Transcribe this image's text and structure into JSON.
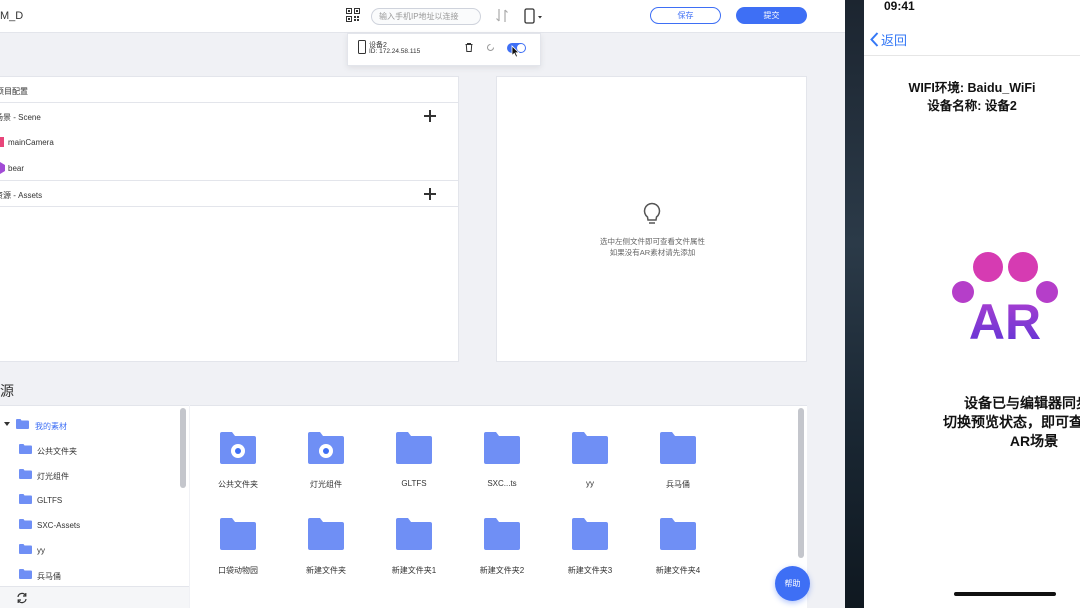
{
  "editor": {
    "title_fragment": "M_D",
    "ip_placeholder": "输入手机IP地址以连接",
    "save_label": "保存",
    "submit_label": "提交",
    "device_popup": {
      "device_name": "设备2",
      "device_ip": "ID: 172.24.58.115",
      "sync_enabled": true
    },
    "project": {
      "header": "项目配置",
      "scene_label": "场景 - Scene",
      "scene_nodes": [
        {
          "label": "mainCamera",
          "color": "#e8457a"
        },
        {
          "label": "bear",
          "color": "#a24bd6"
        }
      ],
      "assets_label": "资源 - Assets"
    },
    "properties": {
      "hint_line1": "选中左侧文件即可查看文件属性",
      "hint_line2": "如果没有AR素材请先添加"
    },
    "resources": {
      "title": "资源",
      "tree_root": "我的素材",
      "tree_items": [
        "公共文件夹",
        "灯光组件",
        "GLTFS",
        "SXC-Assets",
        "yy",
        "兵马俑"
      ],
      "files": [
        {
          "label": "公共文件夹",
          "shared": true
        },
        {
          "label": "灯光组件",
          "shared": true
        },
        {
          "label": "GLTFS",
          "shared": false
        },
        {
          "label": "SXC...ts",
          "shared": false
        },
        {
          "label": "yy",
          "shared": false
        },
        {
          "label": "兵马俑",
          "shared": false
        },
        {
          "label": "口袋动物园",
          "shared": false
        },
        {
          "label": "新建文件夹",
          "shared": false
        },
        {
          "label": "新建文件夹1",
          "shared": false
        },
        {
          "label": "新建文件夹2",
          "shared": false
        },
        {
          "label": "新建文件夹3",
          "shared": false
        },
        {
          "label": "新建文件夹4",
          "shared": false
        }
      ]
    },
    "help_label": "帮助",
    "accent_color": "#3e6ff5",
    "folder_color": "#6f8ff5"
  },
  "phone": {
    "time": "09:41",
    "back_label": "返回",
    "wifi_text": "WIFI环境: Baidu_WiFi",
    "device_text": "设备名称: 设备2",
    "sync_line1": "设备已与编辑器同步，",
    "sync_line2": "切换预览状态，即可查看您的",
    "sync_line3": "AR场景",
    "logo_text": "AR"
  }
}
